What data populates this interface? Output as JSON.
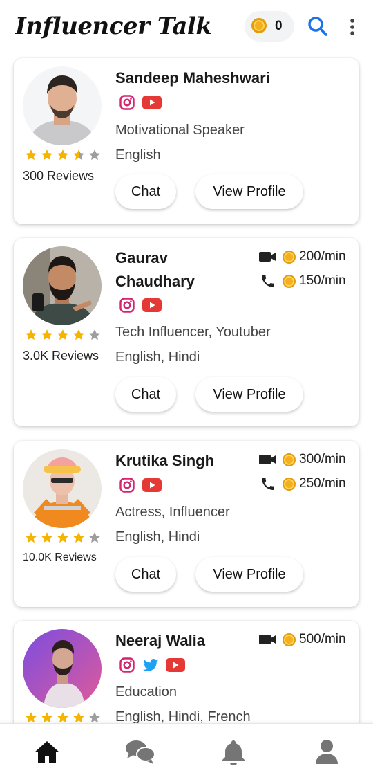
{
  "app": {
    "title": "Influencer Talk",
    "coins": "0"
  },
  "colors": {
    "accent": "#1a73e8",
    "star": "#f4b400",
    "star_empty": "#9e9e9e",
    "instagram": "#d6246e",
    "youtube": "#e53935",
    "twitter": "#1da1f2"
  },
  "influencers": [
    {
      "name": "Sandeep Maheshwari",
      "socials": [
        "instagram-icon",
        "youtube-icon"
      ],
      "category": "Motivational Speaker",
      "languages": "English",
      "rating": 3.5,
      "reviews": "300 Reviews",
      "chat_label": "Chat",
      "profile_label": "View Profile"
    },
    {
      "name_line1": "Gaurav",
      "name_line2": "Chaudhary",
      "socials": [
        "instagram-icon",
        "youtube-icon"
      ],
      "category": "Tech Influencer, Youtuber",
      "languages": "English, Hindi",
      "rating": 4,
      "reviews": "3.0K Reviews",
      "video_rate": "200/min",
      "call_rate": "150/min",
      "chat_label": "Chat",
      "profile_label": "View Profile"
    },
    {
      "name": "Krutika Singh",
      "socials": [
        "instagram-icon",
        "youtube-icon"
      ],
      "category": "Actress, Influencer",
      "languages": "English, Hindi",
      "rating": 4,
      "reviews": "10.0K Reviews",
      "video_rate": "300/min",
      "call_rate": "250/min",
      "chat_label": "Chat",
      "profile_label": "View Profile"
    },
    {
      "name": "Neeraj Walia",
      "socials": [
        "instagram-icon",
        "twitter-icon",
        "youtube-icon"
      ],
      "category": "Education",
      "languages": "English, Hindi, French",
      "rating": 4,
      "video_rate": "500/min"
    }
  ],
  "bottom_nav": [
    "home-icon",
    "chat-bubbles-icon",
    "bell-icon",
    "profile-icon"
  ]
}
